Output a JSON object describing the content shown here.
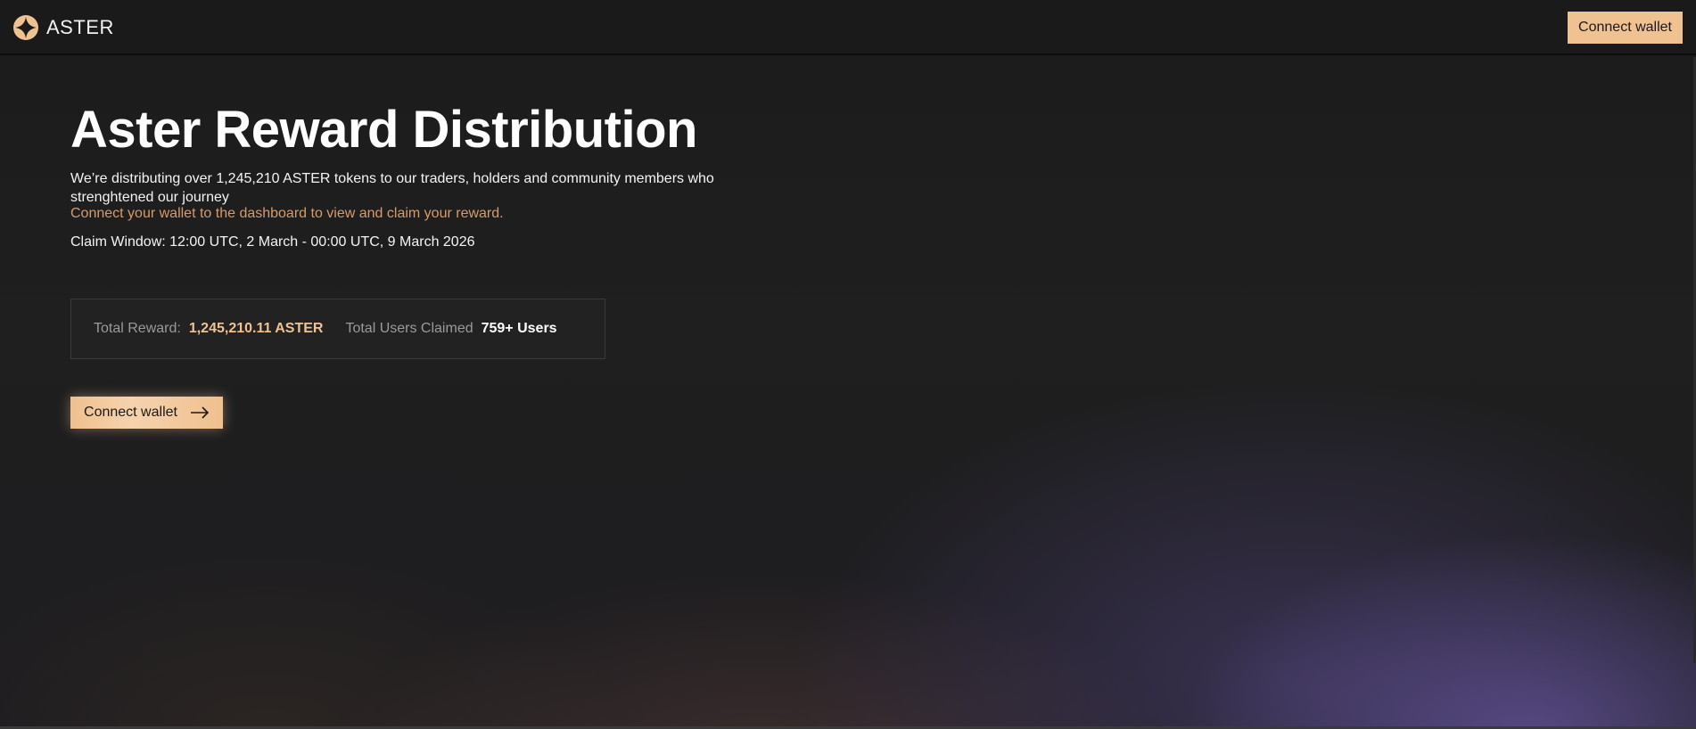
{
  "header": {
    "brand": "ASTER",
    "connect_label": "Connect wallet"
  },
  "hero": {
    "title": "Aster Reward Distribution",
    "description": "We’re distributing over 1,245,210 ASTER tokens to our traders, holders and community members who strenghtened our journey",
    "hint": "Connect your wallet to the dashboard to view and claim your reward.",
    "claim_window": "Claim Window: 12:00 UTC, 2 March - 00:00 UTC, 9 March 2026",
    "stats": {
      "total_reward_label": "Total Reward:",
      "total_reward_value": "1,245,210.11 ASTER",
      "users_claimed_label": "Total Users Claimed",
      "users_claimed_value": "759+ Users"
    },
    "connect_label": "Connect wallet"
  },
  "icons": {
    "logo": "aster-logo-icon",
    "arrow": "arrow-right-icon"
  },
  "colors": {
    "accent": "#f0c291",
    "hint": "#d99a6b",
    "background": "#1b1b1b"
  }
}
